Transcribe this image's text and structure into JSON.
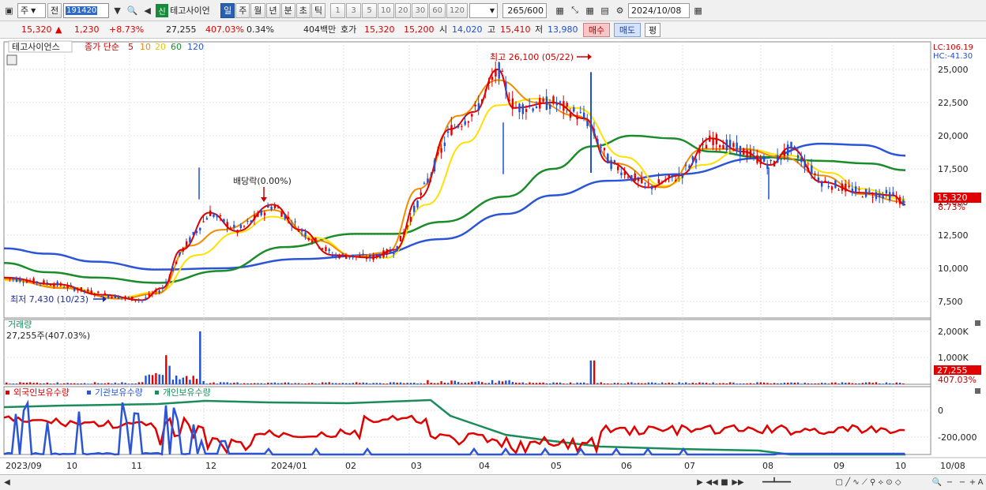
{
  "toolbar": {
    "type_label": "주",
    "prev_label": "전",
    "stock_code": "191420",
    "stock_name": "테고사이언",
    "badge_new": "신",
    "periods": [
      "일",
      "주",
      "월",
      "년",
      "분",
      "초",
      "틱"
    ],
    "selected_period": "일",
    "minute_options": [
      "1",
      "3",
      "5",
      "10",
      "20",
      "30",
      "60",
      "120"
    ],
    "count_display": "265",
    "count_total": "/600",
    "date": "2024/10/08"
  },
  "quote": {
    "price": "15,320",
    "change": "1,230",
    "change_pct": "+8.73%",
    "volume": "27,255",
    "vol_ratio": "407.03%",
    "turnover": "0.34%",
    "amount": "404백만",
    "ask_label": "호가",
    "ask1": "15,320",
    "ask2": "15,200",
    "open_label": "시",
    "open": "14,020",
    "high_label": "고",
    "high": "15,410",
    "low_label": "저",
    "low": "13,980",
    "buy": "매수",
    "sell": "매도",
    "eval": "평"
  },
  "price_panel": {
    "name": "테고사이언스",
    "ma_title": "종가 단순",
    "ma_periods": [
      "5",
      "10",
      "20",
      "60",
      "120"
    ],
    "ma_colors": [
      "#e00000",
      "#f08c00",
      "#ffe000",
      "#1a8c2a",
      "#2b55d6"
    ],
    "lc": "LC:106.19",
    "hc": "HC:-41.30",
    "y_ticks": [
      "25,000",
      "22,500",
      "20,000",
      "17,500",
      "15,000",
      "12,500",
      "10,000",
      "7,500"
    ],
    "last_price": "15,320",
    "last_pct": "8.73%",
    "high_note": "최고 26,100 (05/22)",
    "low_note": "최저 7,430 (10/23)",
    "dividend_note": "배당락(0.00%)"
  },
  "volume_panel": {
    "title": "거래량",
    "subtitle": "27,255주(407.03%)",
    "y_ticks": [
      "2,000K",
      "1,000K"
    ],
    "last": "27,255",
    "last_pct": "407.03%"
  },
  "holdings_panel": {
    "legend": [
      "외국인보유수량",
      "기관보유수량",
      "개인보유수량"
    ],
    "colors": [
      "#e00000",
      "#2b55d6",
      "#1a8c5a"
    ],
    "y_ticks": [
      "0",
      "-200,000"
    ]
  },
  "x_labels": [
    "2023/09",
    "10",
    "11",
    "12",
    "2024/01",
    "02",
    "03",
    "04",
    "05",
    "06",
    "07",
    "08",
    "09",
    "10",
    "10/08"
  ]
}
